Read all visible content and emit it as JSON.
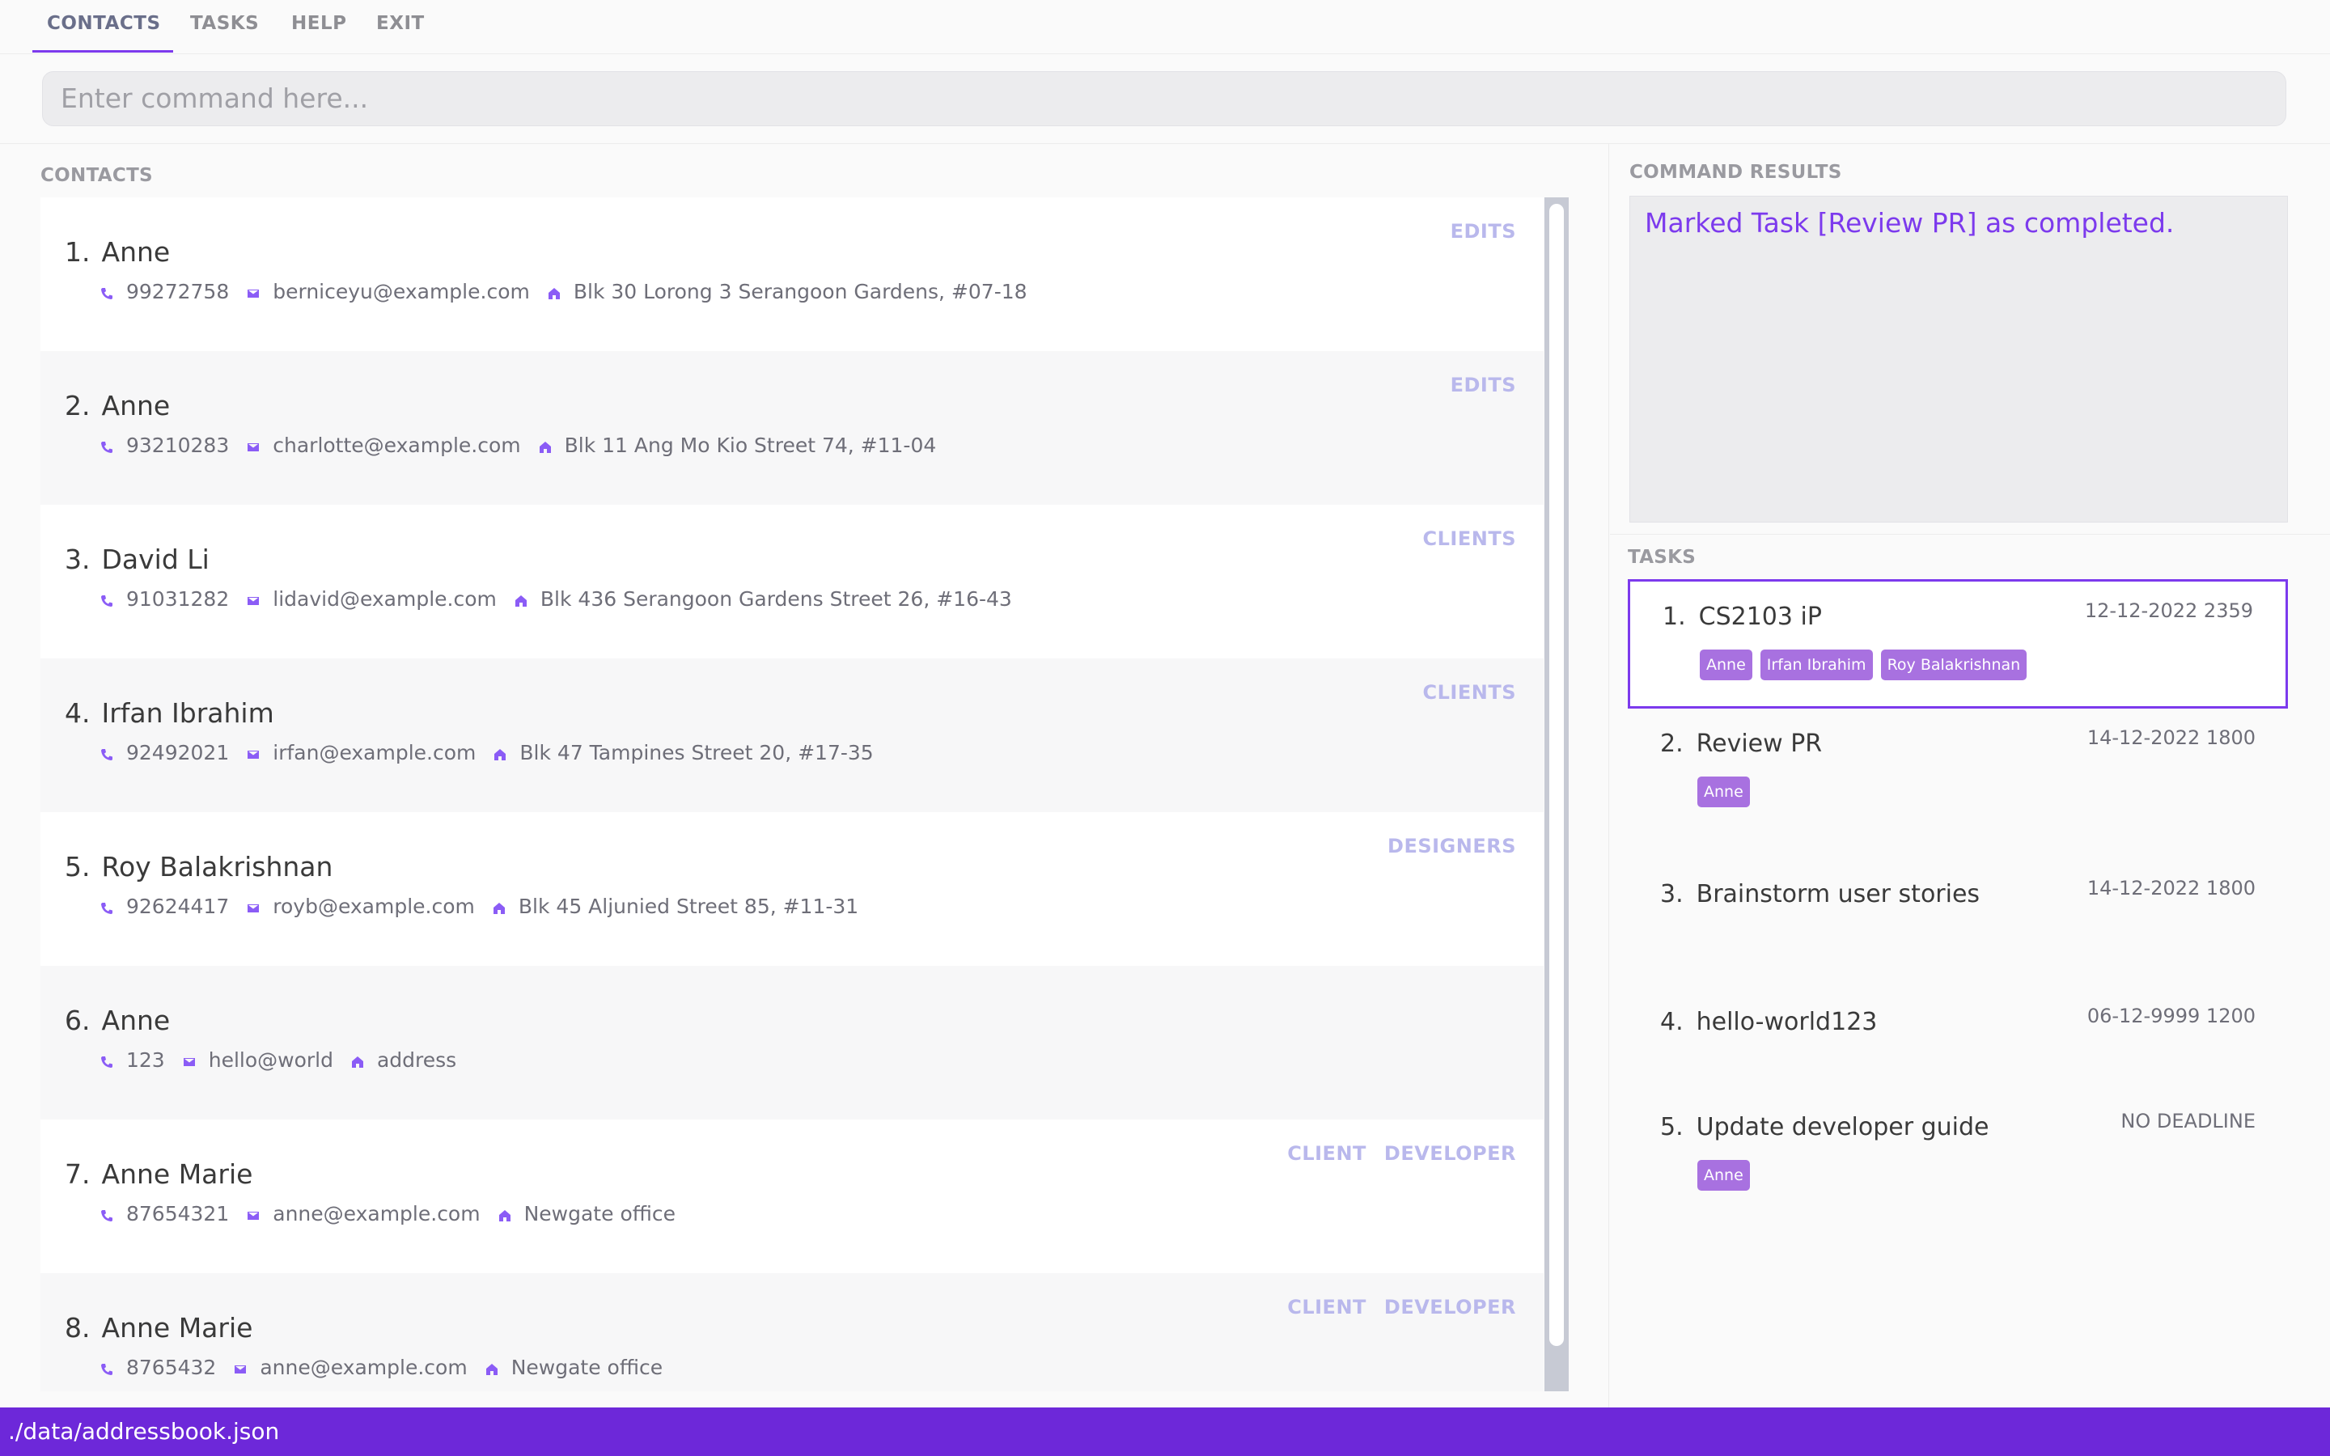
{
  "menu": {
    "items": [
      "CONTACTS",
      "TASKS",
      "HELP",
      "EXIT"
    ],
    "active": "CONTACTS"
  },
  "command_box": {
    "placeholder": "Enter command here..."
  },
  "contacts_pane": {
    "title": "CONTACTS",
    "contacts": [
      {
        "index": "1.",
        "name": "Anne",
        "phone": "99272758",
        "email": "berniceyu@example.com",
        "address": "Blk 30 Lorong 3 Serangoon Gardens, #07-18",
        "tags": [
          "EDITS"
        ]
      },
      {
        "index": "2.",
        "name": "Anne",
        "phone": "93210283",
        "email": "charlotte@example.com",
        "address": "Blk 11 Ang Mo Kio Street 74, #11-04",
        "tags": [
          "EDITS"
        ]
      },
      {
        "index": "3.",
        "name": "David Li",
        "phone": "91031282",
        "email": "lidavid@example.com",
        "address": "Blk 436 Serangoon Gardens Street 26, #16-43",
        "tags": [
          "CLIENTS"
        ]
      },
      {
        "index": "4.",
        "name": "Irfan Ibrahim",
        "phone": "92492021",
        "email": "irfan@example.com",
        "address": "Blk 47 Tampines Street 20, #17-35",
        "tags": [
          "CLIENTS"
        ]
      },
      {
        "index": "5.",
        "name": "Roy Balakrishnan",
        "phone": "92624417",
        "email": "royb@example.com",
        "address": "Blk 45 Aljunied Street 85, #11-31",
        "tags": [
          "DESIGNERS"
        ]
      },
      {
        "index": "6.",
        "name": "Anne",
        "phone": "123",
        "email": "hello@world",
        "address": "address",
        "tags": []
      },
      {
        "index": "7.",
        "name": "Anne Marie",
        "phone": "87654321",
        "email": "anne@example.com",
        "address": "Newgate office",
        "tags": [
          "CLIENT",
          "DEVELOPER"
        ]
      },
      {
        "index": "8.",
        "name": "Anne Marie",
        "phone": "8765432",
        "email": "anne@example.com",
        "address": "Newgate office",
        "tags": [
          "CLIENT",
          "DEVELOPER"
        ]
      }
    ]
  },
  "results_pane": {
    "title": "COMMAND RESULTS",
    "text": "Marked Task [Review PR] as completed."
  },
  "tasks_pane": {
    "title": "TASKS",
    "tasks": [
      {
        "index": "1.",
        "name": "CS2103 iP",
        "deadline": "12-12-2022 2359",
        "assignees": [
          "Anne",
          "Irfan Ibrahim",
          "Roy Balakrishnan"
        ],
        "selected": true
      },
      {
        "index": "2.",
        "name": "Review PR",
        "deadline": "14-12-2022 1800",
        "assignees": [
          "Anne"
        ],
        "selected": false
      },
      {
        "index": "3.",
        "name": "Brainstorm user stories",
        "deadline": "14-12-2022 1800",
        "assignees": [],
        "selected": false
      },
      {
        "index": "4.",
        "name": "hello-world123",
        "deadline": "06-12-9999 1200",
        "assignees": [],
        "selected": false
      },
      {
        "index": "5.",
        "name": "Update developer guide",
        "deadline": "NO DEADLINE",
        "assignees": [
          "Anne"
        ],
        "selected": false
      }
    ]
  },
  "status_bar": {
    "path": "./data/addressbook.json"
  },
  "colors": {
    "accent": "#7c3aed",
    "status_bar": "#6d28d9",
    "tag_bg": "#a871e0",
    "contact_tag": "#b9b8ec"
  },
  "icons": {
    "phone": "phone-icon",
    "email": "email-icon",
    "address": "home-icon"
  }
}
